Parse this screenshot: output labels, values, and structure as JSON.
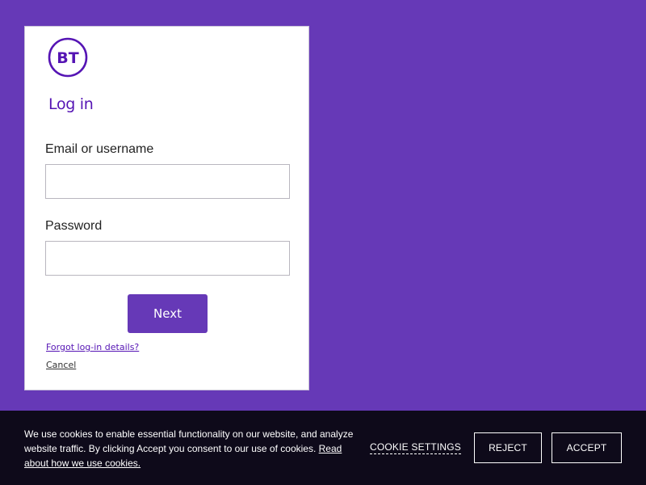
{
  "brand": {
    "logo_text": "BT",
    "color": "#5514b4",
    "background": "#6639b7"
  },
  "login": {
    "title": "Log in",
    "email_label": "Email or username",
    "email_value": "",
    "password_label": "Password",
    "password_value": "",
    "next_label": "Next",
    "forgot_label": "Forgot log-in details?",
    "cancel_label": "Cancel"
  },
  "cookie_banner": {
    "text": "We use cookies to enable essential functionality on our website, and analyze website traffic. By clicking Accept you consent to our use of cookies.",
    "read_link": "Read about how we use cookies.",
    "settings_label": "COOKIE SETTINGS",
    "reject_label": "REJECT",
    "accept_label": "ACCEPT"
  }
}
